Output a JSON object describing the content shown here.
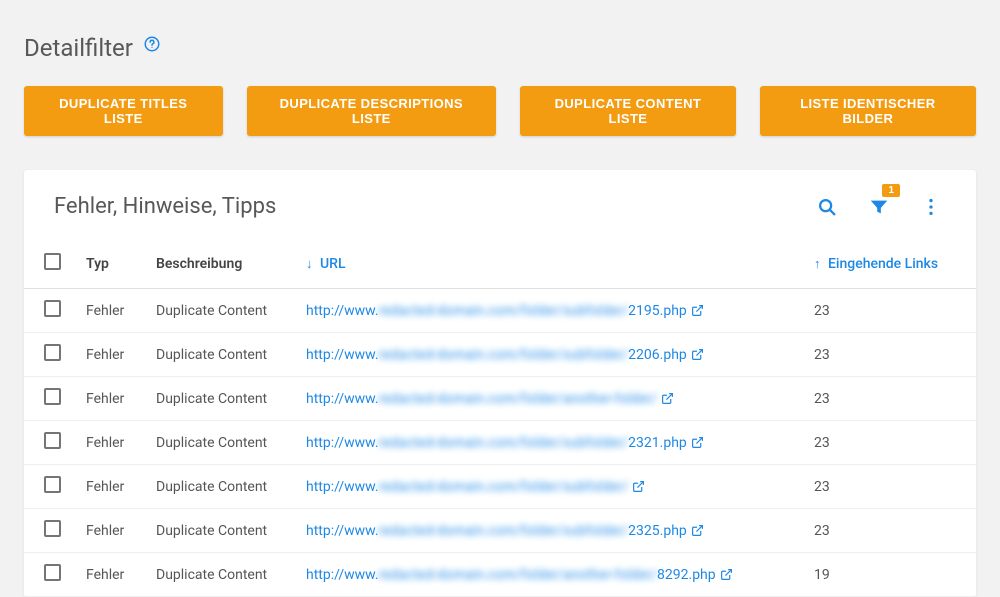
{
  "header": {
    "title": "Detailfilter"
  },
  "filterButtons": [
    "DUPLICATE TITLES LISTE",
    "DUPLICATE DESCRIPTIONS LISTE",
    "DUPLICATE CONTENT LISTE",
    "LISTE IDENTISCHER BILDER"
  ],
  "card": {
    "title": "Fehler, Hinweise, Tipps",
    "filterBadge": "1",
    "columns": {
      "typ": "Typ",
      "beschreibung": "Beschreibung",
      "url": "URL",
      "links": "Eingehende Links"
    },
    "rows": [
      {
        "typ": "Fehler",
        "desc": "Duplicate Content",
        "urlPrefix": "http://www.",
        "urlHidden": "redacted-domain.com/folder/subfolder/",
        "urlSuffix": "2195.php",
        "links": "23"
      },
      {
        "typ": "Fehler",
        "desc": "Duplicate Content",
        "urlPrefix": "http://www.",
        "urlHidden": "redacted-domain.com/folder/subfolder/",
        "urlSuffix": "2206.php",
        "links": "23"
      },
      {
        "typ": "Fehler",
        "desc": "Duplicate Content",
        "urlPrefix": "http://www.",
        "urlHidden": "redacted-domain.com/folder/another-folder/",
        "urlSuffix": "",
        "links": "23"
      },
      {
        "typ": "Fehler",
        "desc": "Duplicate Content",
        "urlPrefix": "http://www.",
        "urlHidden": "redacted-domain.com/folder/subfolder/",
        "urlSuffix": "2321.php",
        "links": "23"
      },
      {
        "typ": "Fehler",
        "desc": "Duplicate Content",
        "urlPrefix": "http://www.",
        "urlHidden": "redacted-domain.com/folder/subfolder/",
        "urlSuffix": "",
        "links": "23"
      },
      {
        "typ": "Fehler",
        "desc": "Duplicate Content",
        "urlPrefix": "http://www.",
        "urlHidden": "redacted-domain.com/folder/subfolder/",
        "urlSuffix": "2325.php",
        "links": "23"
      },
      {
        "typ": "Fehler",
        "desc": "Duplicate Content",
        "urlPrefix": "http://www.",
        "urlHidden": "redacted-domain.com/folder/another-folder/",
        "urlSuffix": "8292.php",
        "links": "19"
      }
    ]
  }
}
